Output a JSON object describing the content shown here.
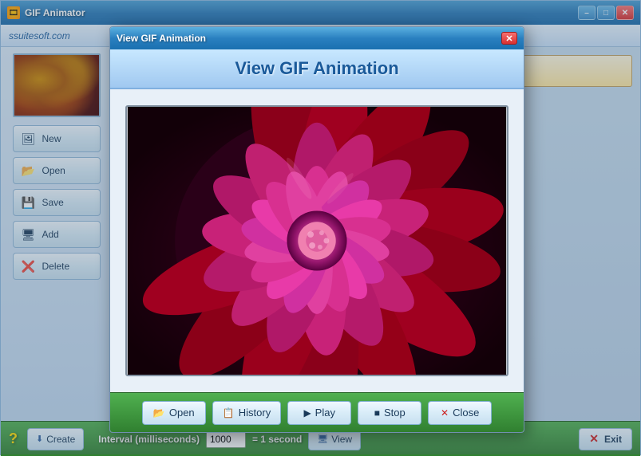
{
  "app": {
    "title": "GIF Animator",
    "brand": "ssuitesoft.com"
  },
  "title_controls": {
    "minimize": "–",
    "maximize": "□",
    "close": "✕"
  },
  "sidebar": {
    "buttons": [
      {
        "id": "new",
        "label": "New",
        "icon": "🖼"
      },
      {
        "id": "open",
        "label": "Open",
        "icon": "📂"
      },
      {
        "id": "save",
        "label": "Save",
        "icon": "💾"
      },
      {
        "id": "add",
        "label": "Add",
        "icon": "🖥"
      },
      {
        "id": "delete",
        "label": "Delete",
        "icon": "❌"
      }
    ]
  },
  "bottom_toolbar": {
    "create_label": "Create",
    "interval_label": "Interval (milliseconds)",
    "interval_value": "1000",
    "interval_unit": "= 1 second",
    "view_label": "View",
    "exit_label": "Exit",
    "help": "?"
  },
  "modal": {
    "title": "View GIF Animation",
    "header_title": "View GIF Animation",
    "close_btn": "✕",
    "buttons": [
      {
        "id": "open",
        "label": "Open",
        "icon": "📂"
      },
      {
        "id": "history",
        "label": "History",
        "icon": "📋"
      },
      {
        "id": "play",
        "label": "Play",
        "icon": "▶"
      },
      {
        "id": "stop",
        "label": "Stop",
        "icon": "■"
      },
      {
        "id": "close",
        "label": "Close",
        "icon": "✕"
      }
    ]
  }
}
